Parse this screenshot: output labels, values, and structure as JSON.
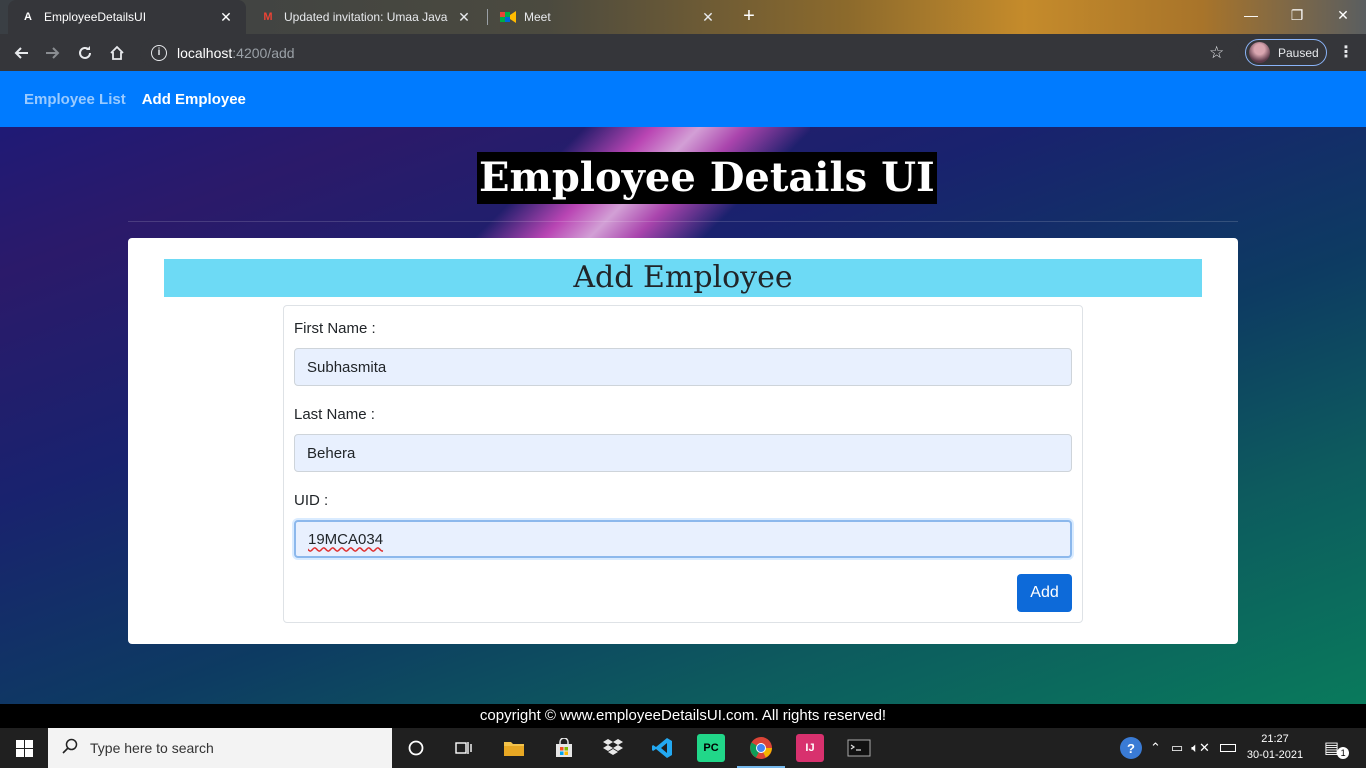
{
  "browser": {
    "tabs": [
      {
        "title": "EmployeeDetailsUI",
        "favicon": "angular-icon"
      },
      {
        "title": "Updated invitation: Umaa Java S",
        "favicon": "gmail-icon"
      },
      {
        "title": "Meet",
        "favicon": "meet-icon"
      }
    ],
    "new_tab": "+",
    "url_host": "localhost",
    "url_path": ":4200/add",
    "profile_status": "Paused"
  },
  "navbar": {
    "employee_list": "Employee List",
    "add_employee": "Add Employee"
  },
  "page": {
    "title": "Employee Details UI",
    "card_title": "Add Employee",
    "form": {
      "first_name_label": "First Name :",
      "first_name_value": "Subhasmita",
      "last_name_label": "Last Name :",
      "last_name_value": "Behera",
      "uid_label": "UID :",
      "uid_value": "19MCA034",
      "submit_label": "Add"
    },
    "footer": "copyright © www.employeeDetailsUI.com. All rights reserved!"
  },
  "taskbar": {
    "search_placeholder": "Type here to search",
    "time": "21:27",
    "date": "30-01-2021",
    "notification_count": "1"
  },
  "colors": {
    "navbar": "#007bff",
    "card_header": "#6ddaf5",
    "add_button": "#0d6ad9"
  }
}
